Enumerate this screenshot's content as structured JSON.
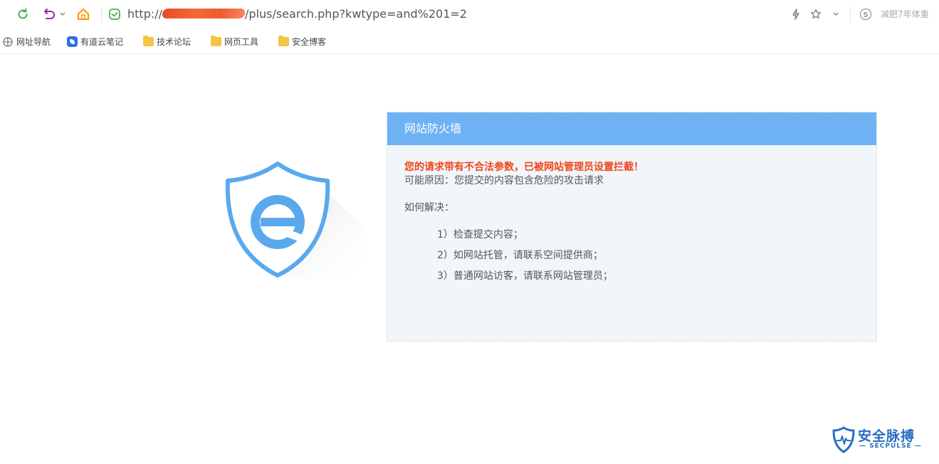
{
  "toolbar": {
    "url_prefix": "http://",
    "url_suffix": "/plus/search.php?kwtype=and%201=2",
    "right_text": "减肥7年体重",
    "icons": [
      "refresh-icon",
      "undo-icon",
      "chevron-down-icon",
      "home-icon",
      "shield-check-icon",
      "lightning-icon",
      "star-icon",
      "chevron-down-icon",
      "search-engine-icon"
    ],
    "colors": {
      "refresh": "#4caf50",
      "undo": "#9c27b0",
      "home": "#ff9800",
      "security": "#4caf50"
    }
  },
  "bookmarks": [
    {
      "label": "网址导航",
      "icon": "grid-icon"
    },
    {
      "label": "有道云笔记",
      "icon": "note-icon"
    },
    {
      "label": "技术论坛",
      "icon": "folder-icon"
    },
    {
      "label": "网页工具",
      "icon": "folder-icon"
    },
    {
      "label": "安全博客",
      "icon": "folder-icon"
    }
  ],
  "panel": {
    "title": "网站防火墙",
    "warning": "您的请求带有不合法参数，已被网站管理员设置拦截！",
    "reason": "可能原因：您提交的内容包含危险的攻击请求",
    "how_label": "如何解决：",
    "steps": [
      "1）检查提交内容；",
      "2）如网站托管，请联系空间提供商；",
      "3）普通网站访客，请联系网站管理员；"
    ],
    "header_color": "#6eb2f4",
    "warning_color": "#f0451c"
  },
  "watermark": {
    "title": "安全脉搏",
    "subtitle": "— SECPULSE —"
  }
}
